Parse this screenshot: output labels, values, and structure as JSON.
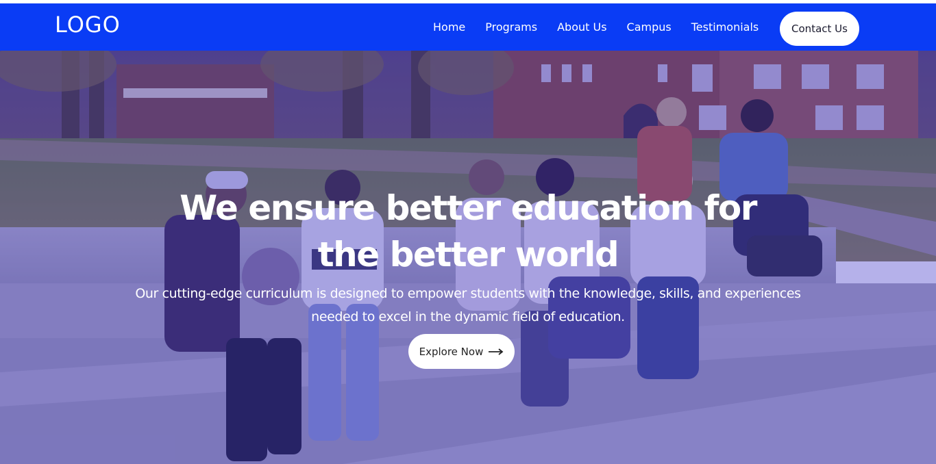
{
  "brand": {
    "logo_text": "LOGO"
  },
  "nav": {
    "links": [
      "Home",
      "Programs",
      "About Us",
      "Campus",
      "Testimonials"
    ],
    "contact_label": "Contact Us"
  },
  "hero": {
    "title_line1": "We ensure better education for",
    "title_line2": "the better world",
    "subtitle_line1": "Our cutting-edge curriculum is designed to empower students with the knowledge, skills, and experiences",
    "subtitle_line2": "needed to excel in the dynamic field of education.",
    "cta_label": "Explore Now",
    "cta_icon": "arrow-right-icon",
    "background_image": "students-sitting-on-campus-steps"
  },
  "colors": {
    "nav_bg": "#0a3cf5",
    "overlay": "#3c32c8",
    "button_bg": "#ffffff",
    "text_light": "#ffffff"
  }
}
